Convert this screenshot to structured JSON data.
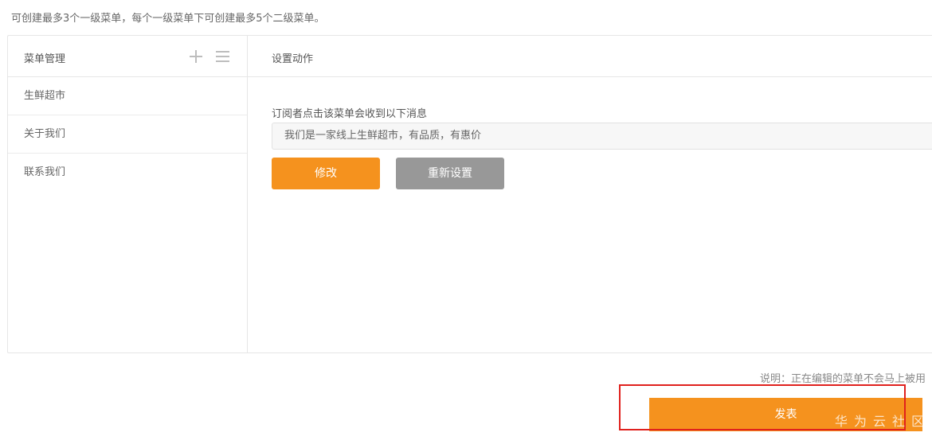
{
  "hint": "可创建最多3个一级菜单，每个一级菜单下可创建最多5个二级菜单。",
  "sidebar": {
    "title": "菜单管理",
    "add_icon": "plus-icon",
    "sort_icon": "list-icon",
    "items": [
      {
        "label": "生鲜超市"
      },
      {
        "label": "关于我们"
      },
      {
        "label": "联系我们"
      }
    ]
  },
  "main": {
    "title": "设置动作",
    "message_label": "订阅者点击该菜单会收到以下消息",
    "message_value": "我们是一家线上生鲜超市，有品质，有惠价",
    "modify_label": "修改",
    "reset_label": "重新设置"
  },
  "footer": {
    "note": "说明：正在编辑的菜单不会马上被用",
    "publish_label": "发表"
  },
  "watermark": "华为云社区",
  "colors": {
    "accent": "#f5921e",
    "secondary_button": "#989898",
    "highlight": "#e0211d"
  }
}
